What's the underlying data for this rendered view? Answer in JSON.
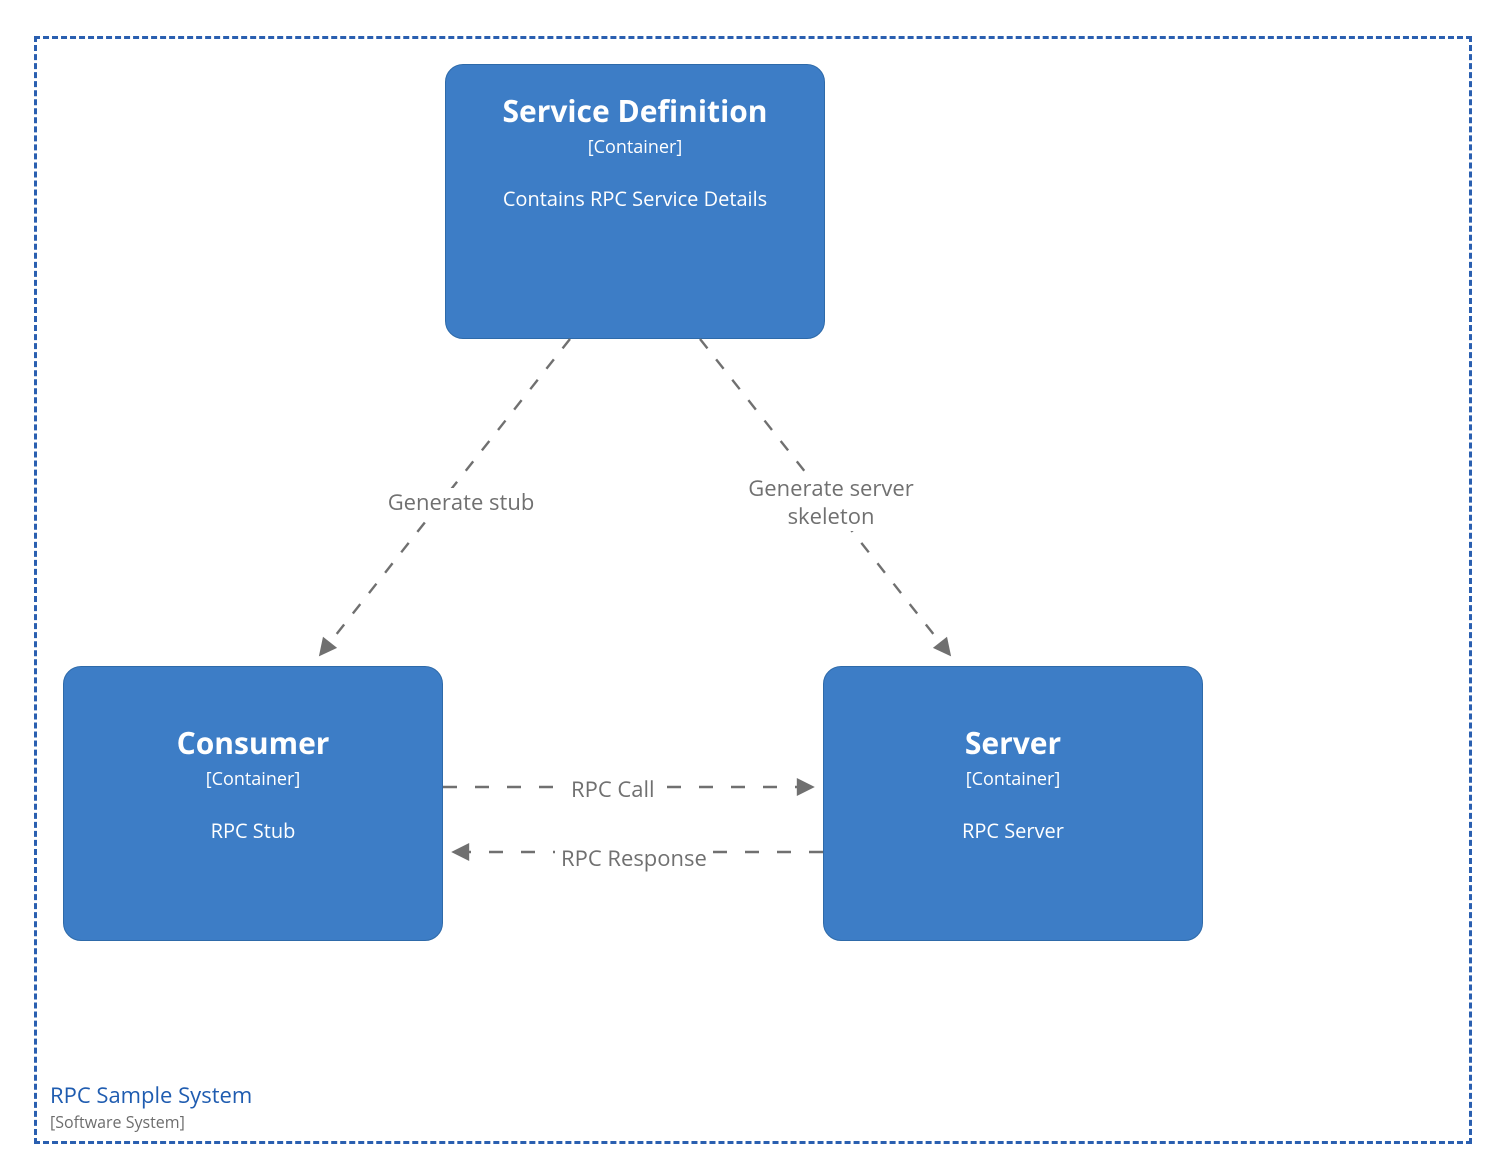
{
  "boundary": {
    "title": "RPC Sample System",
    "subtitle": "[Software System]"
  },
  "nodes": {
    "service_definition": {
      "title": "Service Definition",
      "type": "[Container]",
      "desc": "Contains RPC Service Details"
    },
    "consumer": {
      "title": "Consumer",
      "type": "[Container]",
      "desc": "RPC Stub"
    },
    "server": {
      "title": "Server",
      "type": "[Container]",
      "desc": "RPC Server"
    }
  },
  "edges": {
    "gen_stub": "Generate stub",
    "gen_skeleton_l1": "Generate server",
    "gen_skeleton_l2": "skeleton",
    "rpc_call": "RPC Call",
    "rpc_response": "RPC Response"
  }
}
